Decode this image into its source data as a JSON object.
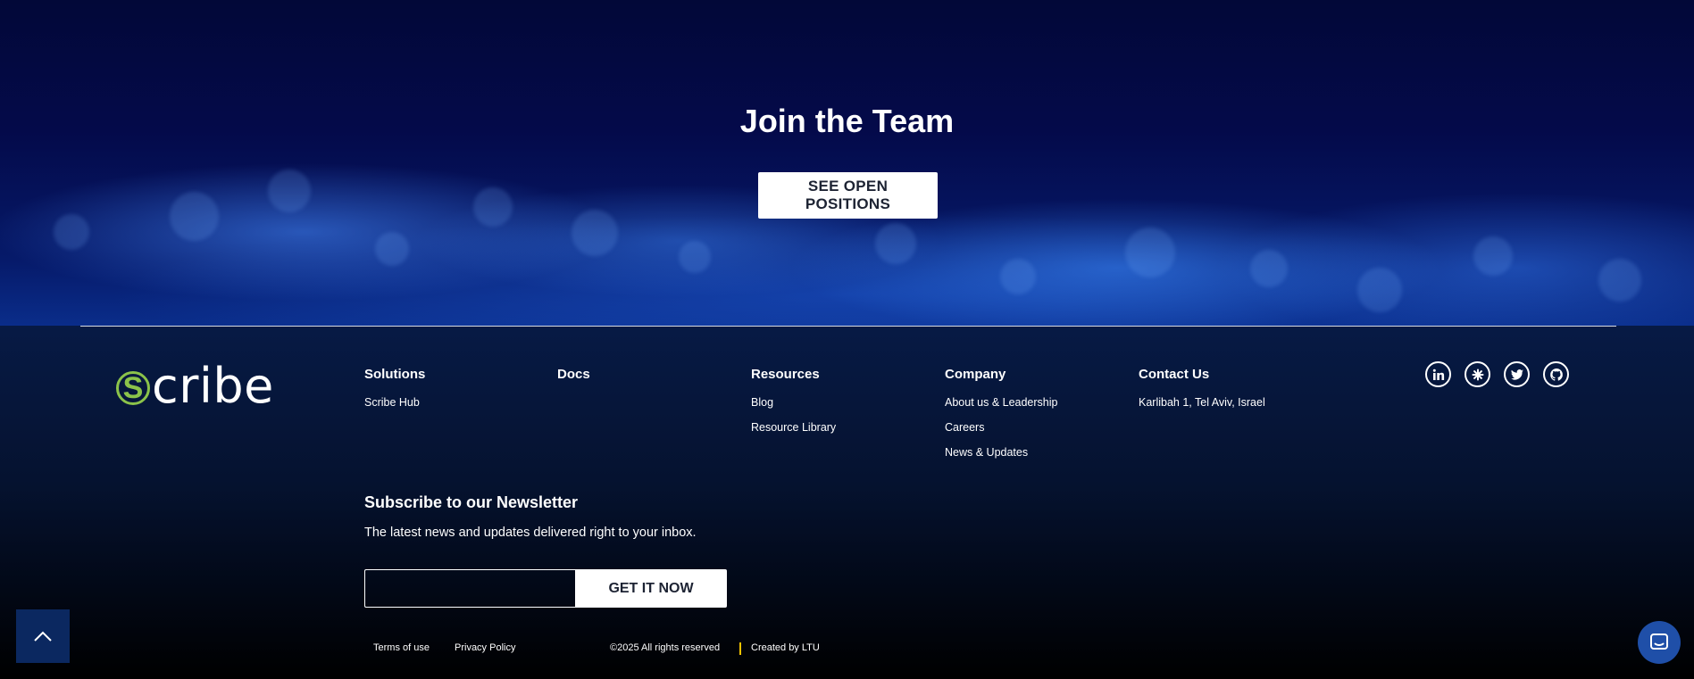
{
  "hero": {
    "title": "Join the Team",
    "cta_label": "SEE OPEN POSITIONS"
  },
  "footer": {
    "logo": {
      "mark_letter": "S",
      "text": "cribe"
    },
    "columns": [
      {
        "title": "Solutions",
        "links": [
          "Scribe Hub"
        ]
      },
      {
        "title": "Docs",
        "links": []
      },
      {
        "title": "Resources",
        "links": [
          "Blog",
          "Resource Library"
        ]
      },
      {
        "title": "Company",
        "links": [
          "About us & Leadership",
          "Careers",
          "News & Updates"
        ]
      },
      {
        "title": "Contact Us",
        "links": [
          "Karlibah 1, Tel Aviv, Israel"
        ]
      }
    ],
    "socials": [
      "linkedin-icon",
      "slack-icon",
      "twitter-icon",
      "github-icon"
    ],
    "newsletter": {
      "title": "Subscribe to our Newsletter",
      "description": "The latest news and updates delivered right to your inbox.",
      "email_value": "",
      "submit_label": "GET IT NOW"
    },
    "legal": {
      "terms": "Terms of use",
      "privacy": "Privacy Policy",
      "copyright": "©2025 All rights reserved",
      "credit": "Created by LTU"
    }
  },
  "colors": {
    "accent_green": "#8bc34a",
    "hero_navy": "#040a4a",
    "button_white": "#ffffff",
    "scroll_top_bg": "#0b2860",
    "chat_bg": "#1f4fa8",
    "separator_yellow": "#f2c200"
  },
  "widgets": {
    "scroll_top_icon": "chevron-up-icon",
    "chat_icon": "chat-icon"
  }
}
